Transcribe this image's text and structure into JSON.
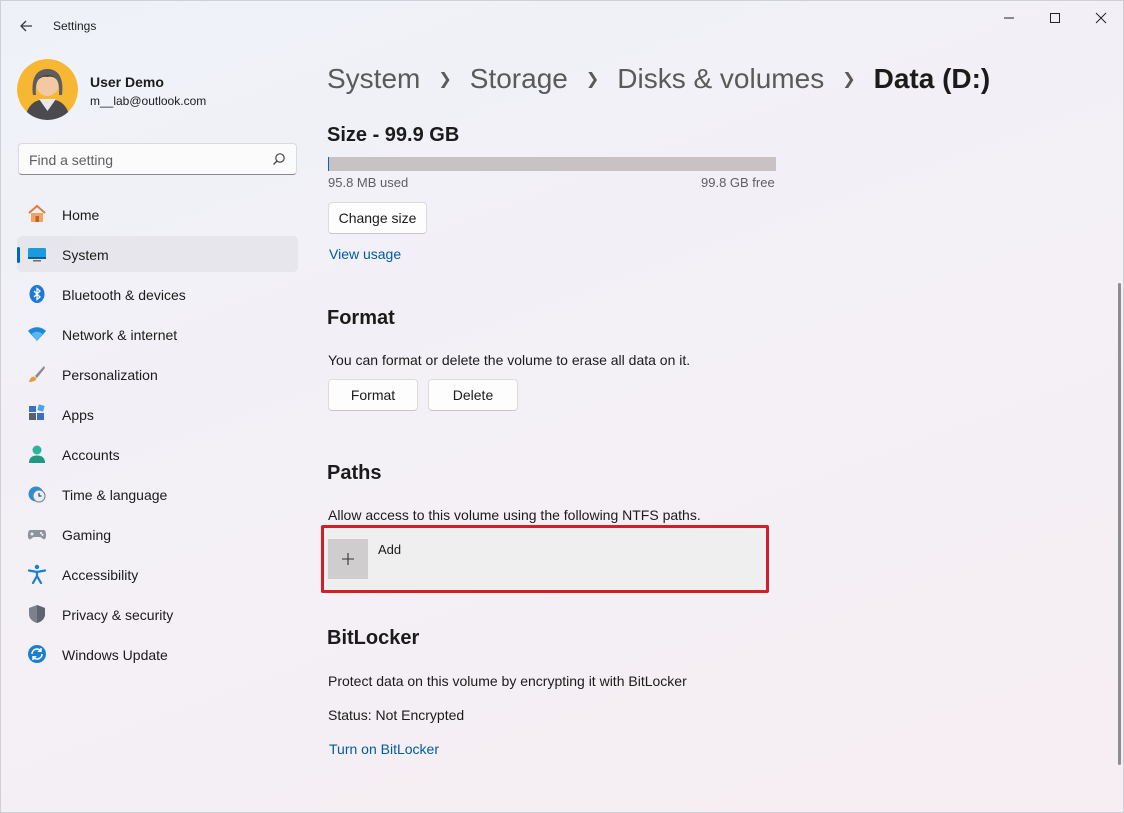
{
  "window": {
    "title": "Settings",
    "controls": [
      "minimize",
      "maximize",
      "close"
    ]
  },
  "profile": {
    "name": "User Demo",
    "email": "m__lab@outlook.com"
  },
  "search": {
    "placeholder": "Find a setting"
  },
  "sidebar": {
    "items": [
      {
        "label": "Home",
        "icon": "home-icon",
        "active": false
      },
      {
        "label": "System",
        "icon": "system-icon",
        "active": true
      },
      {
        "label": "Bluetooth & devices",
        "icon": "bluetooth-icon",
        "active": false
      },
      {
        "label": "Network & internet",
        "icon": "wifi-icon",
        "active": false
      },
      {
        "label": "Personalization",
        "icon": "brush-icon",
        "active": false
      },
      {
        "label": "Apps",
        "icon": "apps-icon",
        "active": false
      },
      {
        "label": "Accounts",
        "icon": "account-icon",
        "active": false
      },
      {
        "label": "Time & language",
        "icon": "clock-globe-icon",
        "active": false
      },
      {
        "label": "Gaming",
        "icon": "gamepad-icon",
        "active": false
      },
      {
        "label": "Accessibility",
        "icon": "accessibility-icon",
        "active": false
      },
      {
        "label": "Privacy & security",
        "icon": "shield-icon",
        "active": false
      },
      {
        "label": "Windows Update",
        "icon": "update-icon",
        "active": false
      }
    ]
  },
  "breadcrumb": [
    "System",
    "Storage",
    "Disks & volumes",
    "Data (D:)"
  ],
  "size": {
    "heading": "Size - 99.9 GB",
    "used_label": "95.8 MB used",
    "free_label": "99.8 GB free",
    "used_fraction": 0.001,
    "change_size_label": "Change size",
    "view_usage_label": "View usage"
  },
  "format": {
    "heading": "Format",
    "description": "You can format or delete the volume to erase all data on it.",
    "format_label": "Format",
    "delete_label": "Delete"
  },
  "paths": {
    "heading": "Paths",
    "description": "Allow access to this volume using the following NTFS paths.",
    "add_label": "Add"
  },
  "bitlocker": {
    "heading": "BitLocker",
    "description": "Protect data on this volume by encrypting it with BitLocker",
    "status": "Status: Not Encrypted",
    "turn_on_label": "Turn on BitLocker"
  },
  "colors": {
    "accent": "#0067c0",
    "highlight": "#d11f2a",
    "link": "#005a9e"
  }
}
